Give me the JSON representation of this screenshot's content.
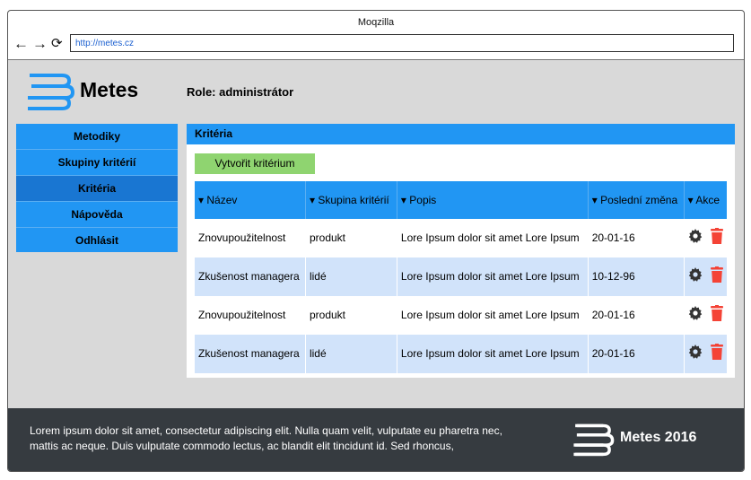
{
  "browser": {
    "title": "Moqzilla",
    "url": "http://metes.cz",
    "back_icon": "←",
    "forward_icon": "→",
    "reload_icon": "⟳"
  },
  "header": {
    "logo_icon": "books-icon",
    "brand": "Metes",
    "role": "Role: administrátor"
  },
  "sidebar": {
    "items": [
      {
        "label": "Metodiky"
      },
      {
        "label": "Skupiny kritérií"
      },
      {
        "label": "Kritéria"
      },
      {
        "label": "Nápověda"
      },
      {
        "label": "Odhlásit"
      }
    ]
  },
  "panel": {
    "title": "Kritéria",
    "create_button": "Vytvořit kritérium",
    "table": {
      "columns": [
        {
          "arrow": "▾",
          "label": "Název"
        },
        {
          "arrow": "▾",
          "label": "Skupina kritérií"
        },
        {
          "arrow": "▾",
          "label": "Popis"
        },
        {
          "arrow": "▾",
          "label": "Poslední změna"
        },
        {
          "arrow": "▾",
          "label": "Akce"
        }
      ],
      "rows": [
        {
          "name": "Znovupoužitelnost",
          "group": "produkt",
          "description": "Lore Ipsum dolor sit amet Lore Ipsum",
          "changed": "20-01-16"
        },
        {
          "name": "Zkušenost managera",
          "group": "lidé",
          "description": "Lore Ipsum dolor sit amet Lore Ipsum",
          "changed": "10-12-96"
        },
        {
          "name": "Znovupoužitelnost",
          "group": "produkt",
          "description": "Lore Ipsum dolor sit amet Lore Ipsum",
          "changed": "20-01-16"
        },
        {
          "name": "Zkušenost managera",
          "group": "lidé",
          "description": "Lore Ipsum dolor sit amet Lore Ipsum",
          "changed": "20-01-16"
        }
      ]
    }
  },
  "footer": {
    "text": "Lorem ipsum dolor sit amet, consectetur adipiscing elit. Nulla quam velit, vulputate eu pharetra nec, mattis ac neque. Duis vulputate commodo lectus, ac blandit elit tincidunt id. Sed rhoncus,",
    "brand": "Metes 2016"
  },
  "colors": {
    "accent": "#2196f3",
    "active_nav": "#1976d2",
    "row_alt": "#d1e3fa",
    "create_button": "#8fd470",
    "delete_icon": "#f44336",
    "footer_bg": "#363b40"
  }
}
